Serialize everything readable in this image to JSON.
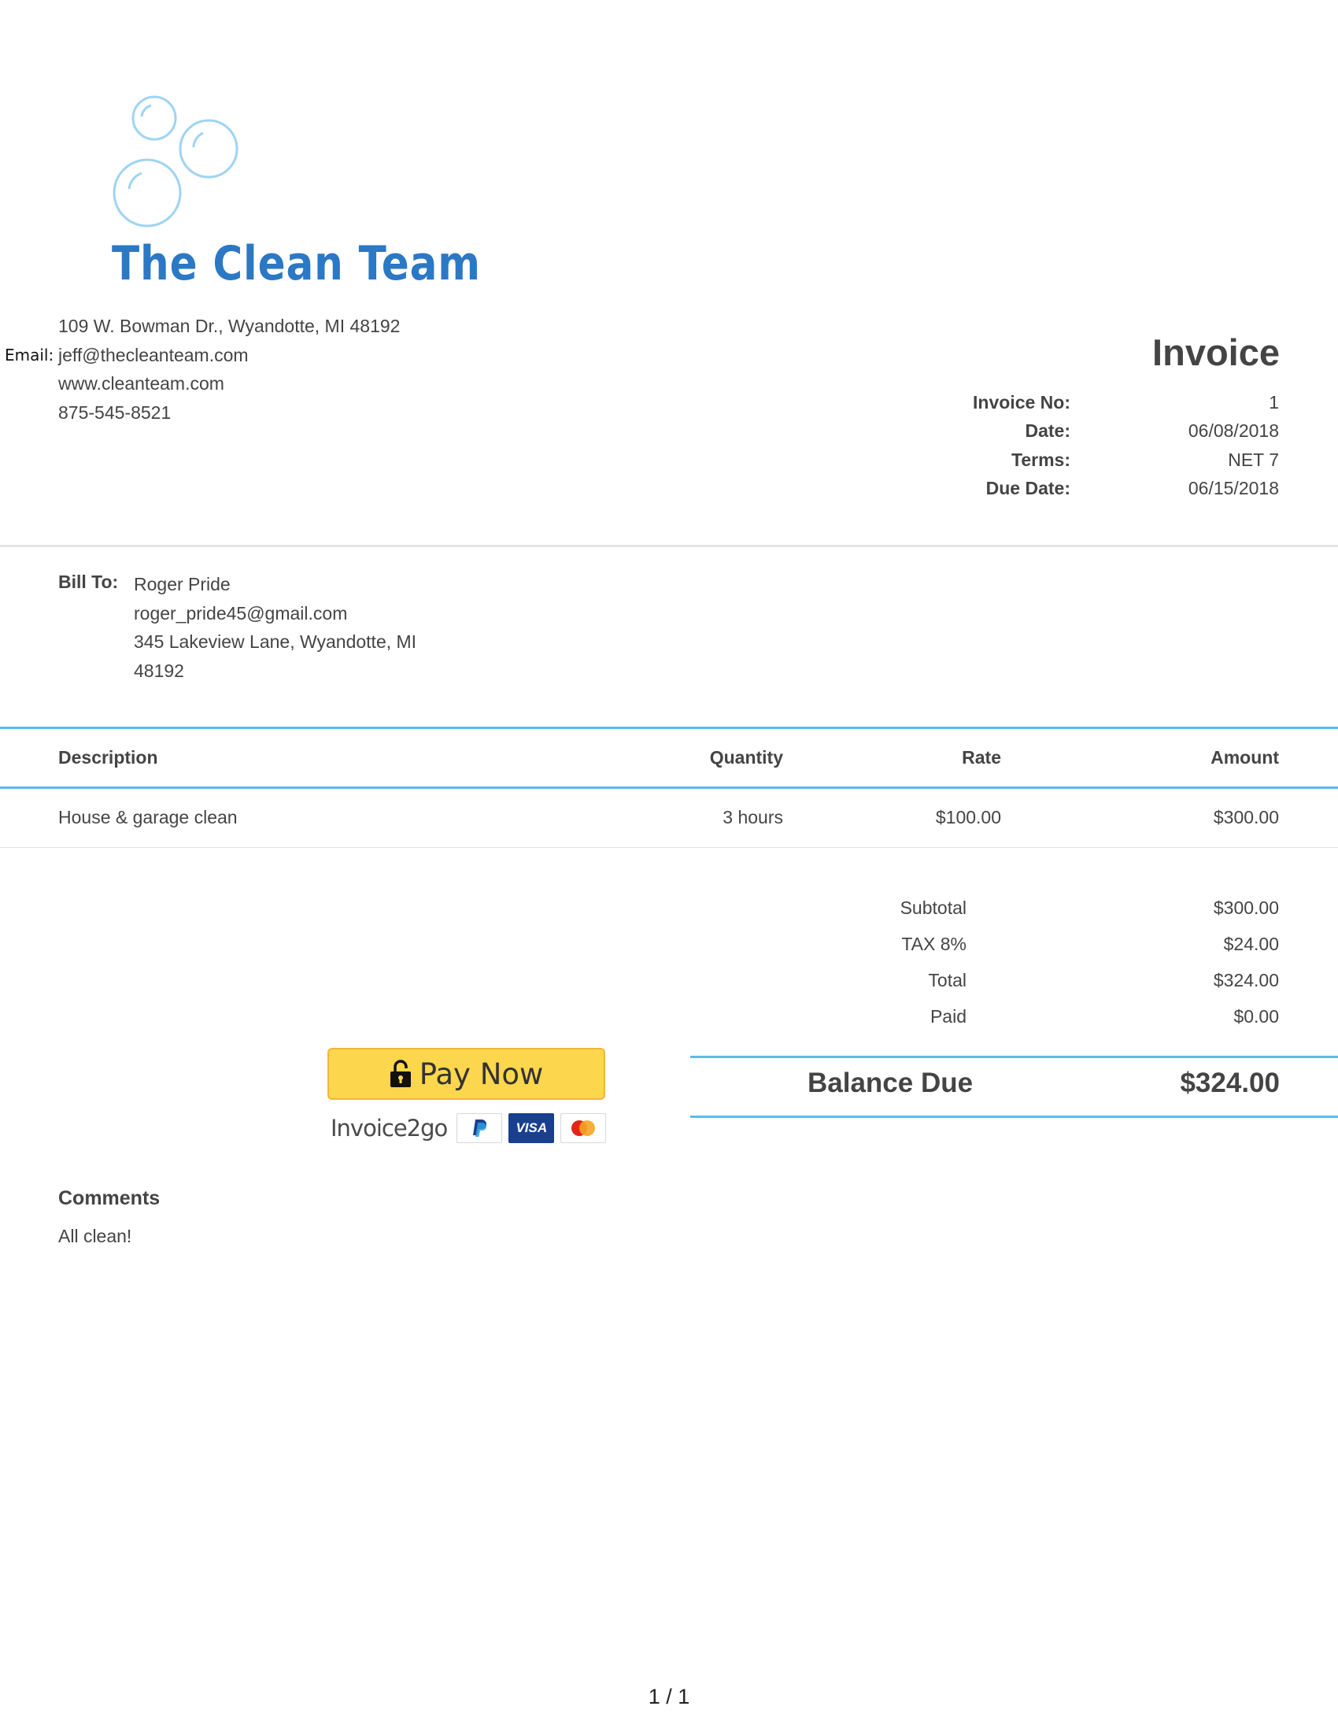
{
  "company": {
    "name": "The Clean Team",
    "address": "109 W. Bowman Dr., Wyandotte, MI 48192",
    "email_label": "Email:",
    "email": "jeff@thecleanteam.com",
    "website": "www.cleanteam.com",
    "phone": "875-545-8521",
    "brand_color": "#2b78c5"
  },
  "invoice": {
    "title": "Invoice",
    "meta": [
      {
        "label": "Invoice No:",
        "value": "1"
      },
      {
        "label": "Date:",
        "value": "06/08/2018"
      },
      {
        "label": "Terms:",
        "value": "NET 7"
      },
      {
        "label": "Due Date:",
        "value": "06/15/2018"
      }
    ]
  },
  "bill_to": {
    "label": "Bill To:",
    "name": "Roger Pride",
    "email": "roger_pride45@gmail.com",
    "address_line1": "345 Lakeview Lane, Wyandotte, MI",
    "address_line2": "48192"
  },
  "table": {
    "headers": {
      "description": "Description",
      "quantity": "Quantity",
      "rate": "Rate",
      "amount": "Amount"
    },
    "rows": [
      {
        "description": "House & garage clean",
        "quantity": "3 hours",
        "rate": "$100.00",
        "amount": "$300.00"
      }
    ]
  },
  "totals": [
    {
      "label": "Subtotal",
      "value": "$300.00"
    },
    {
      "label": "TAX 8%",
      "value": "$24.00"
    },
    {
      "label": "Total",
      "value": "$324.00"
    },
    {
      "label": "Paid",
      "value": "$0.00"
    }
  ],
  "balance": {
    "label": "Balance Due",
    "value": "$324.00"
  },
  "payment": {
    "button_label": "Pay Now",
    "provider": "Invoice2go",
    "cards": [
      "paypal-icon",
      "visa-icon",
      "mastercard-icon"
    ],
    "visa_text": "VISA",
    "button_color": "#fcd64c"
  },
  "comments": {
    "heading": "Comments",
    "text": "All clean!"
  },
  "page_indicator": "1 / 1",
  "accent_color": "#5bbbe9"
}
